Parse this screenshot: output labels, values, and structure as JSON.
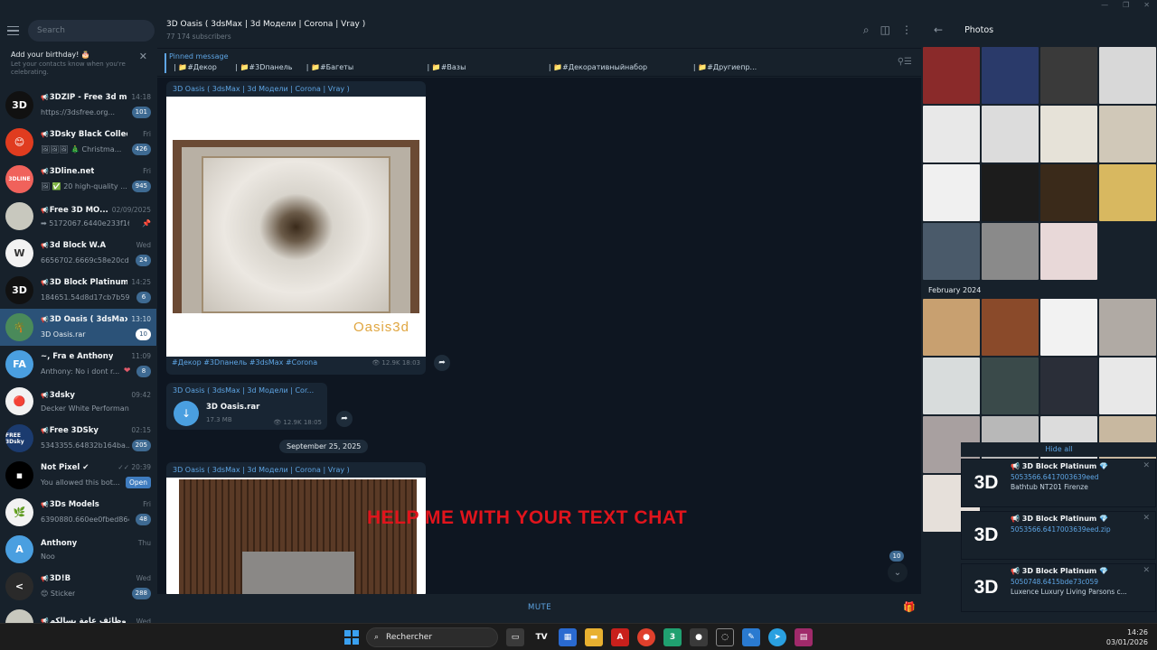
{
  "app": {
    "accent": "#5ea5e4",
    "active_bg": "#2b5278"
  },
  "sidebar": {
    "search_placeholder": "Search",
    "birthday": {
      "title": "Add your birthday! 🎂",
      "subtitle": "Let your contacts know when you're celebrating."
    },
    "chats": [
      {
        "name": "3DZIP - Free 3d mo...",
        "time": "14:18",
        "preview": "https://3dsfree.org...",
        "badge": "101",
        "avatar_text": "3D",
        "avatar_color": "#111111",
        "channel": true
      },
      {
        "name": "3Dsky Black Collectio...",
        "time": "Fri",
        "preview": "🖼🖼🖼 🎄 Christma...",
        "badge": "426",
        "avatar_text": "😊",
        "avatar_color": "#e03c1f",
        "channel": true
      },
      {
        "name": "3Dline.net",
        "time": "Fri",
        "preview": "🖼 ✅ 20 high-quality ...",
        "badge": "945",
        "avatar_text": "3DLINE",
        "avatar_color": "#f0625b",
        "channel": true
      },
      {
        "name": "Free 3D MO...",
        "time": "02/09/2025",
        "preview": "➡ 5172067.6440e233f16...",
        "badge": "",
        "avatar_text": "",
        "avatar_color": "#c8c8be",
        "channel": true
      },
      {
        "name": "3d Block W.A",
        "time": "Wed",
        "preview": "6656702.6669c58e20cd0...",
        "badge": "24",
        "avatar_text": "W",
        "avatar_color": "#f2f2f2",
        "channel": true
      },
      {
        "name": "3D Block Platinum...",
        "time": "14:25",
        "preview": "184651.54d8d17cb7b59...",
        "badge": "6",
        "avatar_text": "3D",
        "avatar_color": "#111111",
        "channel": true
      },
      {
        "name": "3D Oasis ( 3dsMax ...",
        "time": "13:10",
        "preview": "3D Oasis.rar",
        "badge": "10",
        "avatar_text": "🌴",
        "avatar_color": "#4a8a5a",
        "channel": true,
        "active": true
      },
      {
        "name": "~, Fra e Anthony",
        "time": "11:09",
        "preview": "Anthony: No i dont r...",
        "badge": "8",
        "avatar_text": "FA",
        "avatar_color": "#4a9fe0",
        "channel": false,
        "heart": true
      },
      {
        "name": "3dsky",
        "time": "09:42",
        "preview": "Decker White Performan...",
        "badge": "",
        "avatar_text": "🔴",
        "avatar_color": "#f2f2f2",
        "channel": true
      },
      {
        "name": "Free 3DSky",
        "time": "02:15",
        "preview": "5343355.64832b164ba...",
        "badge": "205",
        "avatar_text": "FREE 3Dsky",
        "avatar_color": "#1b3b6f",
        "channel": true
      },
      {
        "name": "Not Pixel ✔",
        "time": "✓✓ 20:39",
        "preview": "You allowed this bot...",
        "badge": "Open",
        "avatar_text": "▪",
        "avatar_color": "#000000",
        "channel": false,
        "bot": true
      },
      {
        "name": "3Ds Models",
        "time": "Fri",
        "preview": "6390880.660ee0fbed864...",
        "badge": "48",
        "avatar_text": "🌿",
        "avatar_color": "#f2f2f2",
        "channel": true
      },
      {
        "name": "Anthony",
        "time": "Thu",
        "preview": "Noo",
        "badge": "",
        "avatar_text": "A",
        "avatar_color": "#4a9fe0",
        "channel": false
      },
      {
        "name": "3D!B",
        "time": "Wed",
        "preview": "😊 Sticker",
        "badge": "288",
        "avatar_text": "<",
        "avatar_color": "#2a2a2a",
        "channel": true
      },
      {
        "name": "وظائف عامة بسالكم ...",
        "time": "Wed",
        "preview": "",
        "badge": "",
        "avatar_text": "",
        "avatar_color": "#c8c8be",
        "channel": true
      }
    ]
  },
  "header": {
    "title": "3D Oasis ( 3dsMax | 3d Модели | Corona | Vray )",
    "subscribers": "77 174 subscribers"
  },
  "pinned": {
    "label": "Pinned message",
    "tags": "| 📁#Декор        | 📁#3Dпанель      | 📁#Багеты                                | 📁#Вазы                                    | 📁#Декоративныйнабор                    | 📁#Другиепр..."
  },
  "messages": {
    "m1": {
      "author": "3D Oasis ( 3dsMax | 3d Модели | Corona | Vray )",
      "watermark": "Oasis3d",
      "tags": "#Декор #3Dпанель #3dsMax #Corona",
      "views": "👁 12.9K  18:03"
    },
    "m2": {
      "author": "3D Oasis ( 3dsMax | 3d Модели | Cor...",
      "file": "3D Oasis.rar",
      "size": "17.3 MB",
      "views": "👁 12.9K  18:05"
    },
    "date": "September 25, 2025",
    "m3": {
      "author": "3D Oasis ( 3dsMax | 3d Модели | Corona | Vray )"
    },
    "overlay": "HELP ME WITH YOUR TEXT CHAT",
    "scroll_badge": "10"
  },
  "bottom": {
    "mute": "MUTE"
  },
  "photos": {
    "title": "Photos",
    "month": "February 2024",
    "hide_all": "Hide all",
    "thumbs_top": [
      "#8a2a2a",
      "#2a3a6a",
      "#3a3a3a",
      "#d8d8d8",
      "#e8e8e8",
      "#dcdcdc",
      "#e6e2d8",
      "#d0c8b8",
      "#f0f0f0",
      "#1c1c1c",
      "#3a2a1a",
      "#d8b860",
      "#4a5a6a",
      "#8a8a8a",
      "#e8d8d8",
      "#17212b"
    ],
    "thumbs_bottom": [
      "#c8a070",
      "#8a4a2a",
      "#f2f2f2",
      "#b0aaa4",
      "#d8dcdc",
      "#3a4a4a",
      "#2a2e38",
      "#e8e8e8",
      "#a8a0a0",
      "#b8b8b8",
      "#dcdcdc",
      "#c8b8a0",
      "#e6e0da",
      "#17212b",
      "#17212b",
      "#17212b"
    ]
  },
  "toasts": [
    {
      "name": "📢 3D Block Platinum 💎",
      "line1": "5053566.6417003639eed",
      "line2": "Bathtub NT201 Firenze"
    },
    {
      "name": "📢 3D Block Platinum 💎",
      "line1": "5053566.6417003639eed.zip",
      "line2": ""
    },
    {
      "name": "📢 3D Block Platinum 💎",
      "line1": "5050748.6415bde73c059",
      "line2": "Luxence Luxury Living Parsons c..."
    }
  ],
  "taskbar": {
    "search": "Rechercher",
    "time": "14:26",
    "date": "03/01/2026"
  }
}
